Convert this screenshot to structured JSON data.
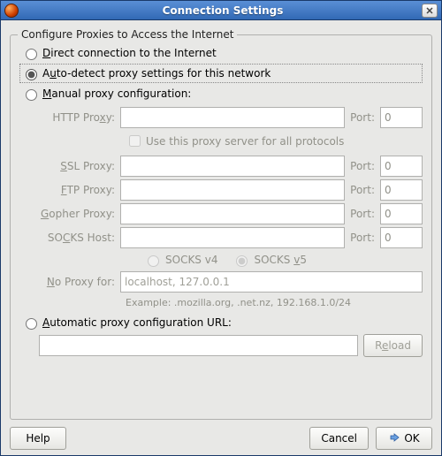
{
  "window": {
    "title": "Connection Settings"
  },
  "group": {
    "title": "Configure Proxies to Access the Internet"
  },
  "radios": {
    "direct": "Direct connection to the Internet",
    "auto": "Auto-detect proxy settings for this network",
    "manual": "Manual proxy configuration:",
    "pac": "Automatic proxy configuration URL:",
    "selected": "auto"
  },
  "proxy": {
    "http_label": "HTTP Proxy:",
    "ssl_label": "SSL Proxy:",
    "ftp_label": "FTP Proxy:",
    "gopher_label": "Gopher Proxy:",
    "socks_label": "SOCKS Host:",
    "noproxy_label": "No Proxy for:",
    "port_label": "Port:",
    "port_value": "0",
    "use_all": "Use this proxy server for all protocols",
    "socks_v4": "SOCKS v4",
    "socks_v5": "SOCKS v5",
    "socks_selected": "v5",
    "noproxy_value": "localhost, 127.0.0.1",
    "example": "Example: .mozilla.org, .net.nz, 192.168.1.0/24"
  },
  "pac": {
    "url": "",
    "reload": "Reload"
  },
  "buttons": {
    "help": "Help",
    "cancel": "Cancel",
    "ok": "OK"
  }
}
